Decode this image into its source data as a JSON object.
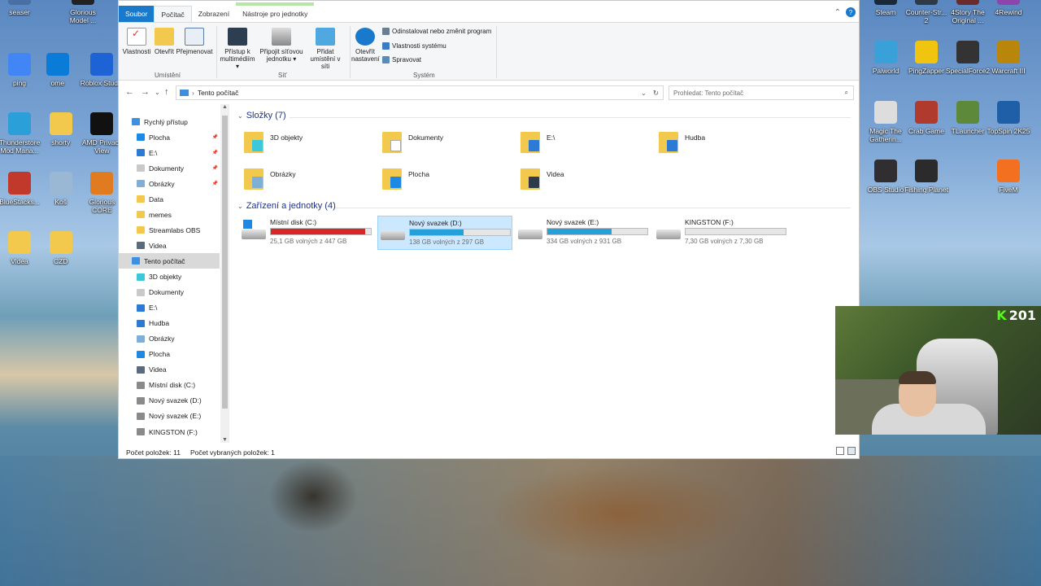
{
  "desktop": {
    "left_icons": [
      {
        "label": "seaser",
        "color": "#4a6fa5"
      },
      {
        "label": "Glorious Model ...",
        "color": "#222222"
      },
      {
        "label": "ping",
        "color": "#4285f4"
      },
      {
        "label": "ome",
        "color": "#0a7cd8"
      },
      {
        "label": "Roblox Stud...",
        "color": "#1e63d6"
      },
      {
        "label": "Thunderstore Mod Mana...",
        "color": "#2a9fd8"
      },
      {
        "label": "shorty",
        "color": "#f2c94c"
      },
      {
        "label": "AMD Privacy View",
        "color": "#111111"
      },
      {
        "label": "BlueStacks...",
        "color": "#c0392b"
      },
      {
        "label": "Koš",
        "color": "#9ab7d3"
      },
      {
        "label": "Glorious CORE",
        "color": "#e07b1f"
      },
      {
        "label": "Videa",
        "color": "#f2c94c"
      },
      {
        "label": "CZD",
        "color": "#f2c94c"
      }
    ],
    "right_icons": [
      {
        "label": "Steam",
        "color": "#1b2838"
      },
      {
        "label": "Counter-Str... 2",
        "color": "#2f3a46"
      },
      {
        "label": "4Story The Original ...",
        "color": "#6a2b2b"
      },
      {
        "label": "4Rewind",
        "color": "#8e44ad"
      },
      {
        "label": "Palworld",
        "color": "#3aa0d8"
      },
      {
        "label": "PingZapper",
        "color": "#f1c40f"
      },
      {
        "label": "SpecialForce2",
        "color": "#333333"
      },
      {
        "label": "Warcraft III",
        "color": "#b8860b"
      },
      {
        "label": "Magic The Gatherin...",
        "color": "#dddddd"
      },
      {
        "label": "Crab Game",
        "color": "#b03a2e"
      },
      {
        "label": "TLauncher",
        "color": "#5d8a3a"
      },
      {
        "label": "TopSpin 2K25",
        "color": "#1f5fa8"
      },
      {
        "label": "OBS Studio",
        "color": "#302e31"
      },
      {
        "label": "Fishing Planet",
        "color": "#2b2b2b"
      },
      {
        "label": "FiveM",
        "color": "#f37021"
      }
    ]
  },
  "ribbon": {
    "tabs": [
      "Soubor",
      "Počítač",
      "Zobrazení",
      "Nástroje pro jednotky"
    ],
    "buttons": {
      "properties": "Vlastnosti",
      "open": "Otevřít",
      "rename": "Přejmenovat",
      "media_access": "Přístup k multimédiím ▾",
      "map_drive": "Připojit síťovou jednotku ▾",
      "add_location": "Přidat umístění v síti",
      "open_settings": "Otevřít nastavení",
      "uninstall": "Odinstalovat nebo změnit program",
      "system_props": "Vlastnosti systému",
      "manage": "Spravovat"
    },
    "groups": {
      "location": "Umístění",
      "network": "Síť",
      "system": "Systém"
    }
  },
  "address": {
    "path": "Tento počítač",
    "search_placeholder": "Prohledat: Tento počítač"
  },
  "nav_pane": [
    {
      "label": "Rychlý přístup",
      "color": "#3d8fe0",
      "pinned": false,
      "indent": 0
    },
    {
      "label": "Plocha",
      "color": "#1e88e5",
      "pinned": true,
      "indent": 1
    },
    {
      "label": "E:\\",
      "color": "#2a7ad6",
      "pinned": true,
      "indent": 1
    },
    {
      "label": "Dokumenty",
      "color": "#c9c9c9",
      "pinned": true,
      "indent": 1
    },
    {
      "label": "Obrázky",
      "color": "#7faed6",
      "pinned": true,
      "indent": 1
    },
    {
      "label": "Data",
      "color": "#f2c94c",
      "pinned": false,
      "indent": 1
    },
    {
      "label": "memes",
      "color": "#f2c94c",
      "pinned": false,
      "indent": 1
    },
    {
      "label": "Streamlabs OBS",
      "color": "#f2c94c",
      "pinned": false,
      "indent": 1
    },
    {
      "label": "Videa",
      "color": "#5a6b7d",
      "pinned": false,
      "indent": 1
    },
    {
      "label": "Tento počítač",
      "color": "#3d8fe0",
      "pinned": false,
      "indent": 0
    },
    {
      "label": "3D objekty",
      "color": "#3cc8d8",
      "pinned": false,
      "indent": 1
    },
    {
      "label": "Dokumenty",
      "color": "#c9c9c9",
      "pinned": false,
      "indent": 1
    },
    {
      "label": "E:\\",
      "color": "#2a7ad6",
      "pinned": false,
      "indent": 1
    },
    {
      "label": "Hudba",
      "color": "#2a7ad6",
      "pinned": false,
      "indent": 1
    },
    {
      "label": "Obrázky",
      "color": "#7faed6",
      "pinned": false,
      "indent": 1
    },
    {
      "label": "Plocha",
      "color": "#1e88e5",
      "pinned": false,
      "indent": 1
    },
    {
      "label": "Videa",
      "color": "#5a6b7d",
      "pinned": false,
      "indent": 1
    },
    {
      "label": "Místní disk (C:)",
      "color": "#8a8a8a",
      "pinned": false,
      "indent": 1
    },
    {
      "label": "Nový svazek (D:)",
      "color": "#8a8a8a",
      "pinned": false,
      "indent": 1
    },
    {
      "label": "Nový svazek (E:)",
      "color": "#8a8a8a",
      "pinned": false,
      "indent": 1
    },
    {
      "label": "KINGSTON (F:)",
      "color": "#8a8a8a",
      "pinned": false,
      "indent": 1
    }
  ],
  "folders_header": "Složky (7)",
  "folders": [
    {
      "label": "3D objekty",
      "overlay": "#3cc8d8"
    },
    {
      "label": "Dokumenty",
      "overlay": "#ffffff"
    },
    {
      "label": "E:\\",
      "overlay": "#2a7ad6"
    },
    {
      "label": "Hudba",
      "overlay": "#2a7ad6"
    },
    {
      "label": "Obrázky",
      "overlay": "#7faed6"
    },
    {
      "label": "Plocha",
      "overlay": "#1e88e5"
    },
    {
      "label": "Videa",
      "overlay": "#2f3b4a"
    }
  ],
  "drives_header": "Zařízení a jednotky (4)",
  "drives": [
    {
      "label": "Místní disk (C:)",
      "free": "25,1 GB volných z 447 GB",
      "used_fraction": 0.944,
      "bar_color": "#da2626",
      "selected": false
    },
    {
      "label": "Nový svazek (D:)",
      "free": "138 GB volných z 297 GB",
      "used_fraction": 0.535,
      "bar_color": "#26a0da",
      "selected": true
    },
    {
      "label": "Nový svazek (E:)",
      "free": "334 GB volných z 931 GB",
      "used_fraction": 0.641,
      "bar_color": "#26a0da",
      "selected": false
    },
    {
      "label": "KINGSTON (F:)",
      "free": "7,30 GB volných z 7,30 GB",
      "used_fraction": 0.0,
      "bar_color": "#26a0da",
      "selected": false
    }
  ],
  "status": {
    "count": "Počet položek: 11",
    "selected": "Počet vybraných položek: 1"
  },
  "webcam": {
    "platform_badge": "K",
    "viewer_count": "201"
  }
}
